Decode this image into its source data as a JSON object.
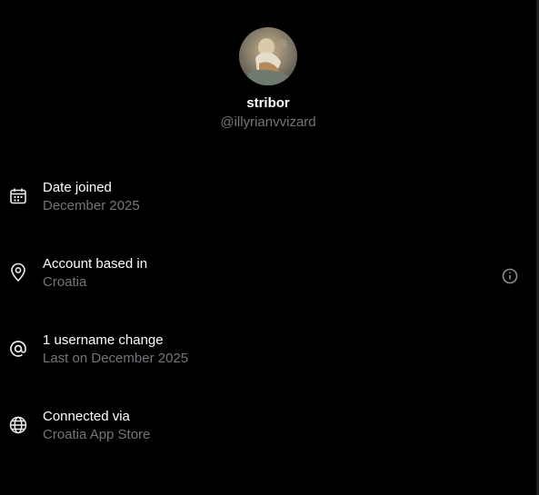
{
  "profile": {
    "display_name": "stribor",
    "handle": "@illyrianvvizard",
    "avatar_icon": "avatar-painting"
  },
  "rows": [
    {
      "icon": "calendar-icon",
      "title": "Date joined",
      "subtitle": "December 2025"
    },
    {
      "icon": "location-pin-icon",
      "title": "Account based in",
      "subtitle": "Croatia"
    },
    {
      "icon": "at-sign-icon",
      "title": "1 username change",
      "subtitle": "Last on December 2025"
    },
    {
      "icon": "globe-icon",
      "title": "Connected via",
      "subtitle": "Croatia App Store"
    }
  ],
  "colors": {
    "background": "#000000",
    "primary_text": "#ffffff",
    "secondary_text": "#71767b"
  }
}
